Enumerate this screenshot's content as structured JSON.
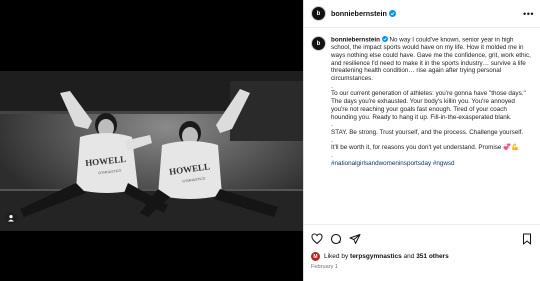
{
  "header": {
    "username": "bonniebernstein",
    "more_label": "•••"
  },
  "caption": {
    "username": "bonniebernstein",
    "paragraph1": "No way I could've known, senior year in high school, the impact sports would have on my life. How it molded me in ways nothing else could have. Gave me the confidence, grit, work ethic, and resilience I'd need to make it in the sports industry… survive a life threatening health condition… rise again after trying personal circumstances.",
    "dot": ".",
    "paragraph2": "To our current generation of athletes: you're gonna have \"those days.\" The days you're exhausted. Your body's killin you. You're annoyed you're not reaching your goals fast enough. Tired of your coach hounding you. Ready to hang it up. Fill-in-the-exasperated blank.",
    "paragraph3": "STAY. Be strong. Trust yourself, and the process. Challenge yourself.",
    "paragraph4": "It'll be worth it, for reasons you don't yet understand. Promise",
    "emoji": "💞💪",
    "hashtags": "#nationalgirlsandwomeninsportsday #ngwsd"
  },
  "photo": {
    "sweatshirt_text_left": "HOWELL",
    "sweatshirt_text_right": "HOWELL",
    "sweatshirt_sub_left": "GYMNASTICS",
    "sweatshirt_sub_right": "GYMNASTICS"
  },
  "likes": {
    "prefix": "Liked by",
    "first_liker": "terpsgymnastics",
    "and": "and",
    "others": "351 others"
  },
  "date": "February 1",
  "colors": {
    "link": "#00376b",
    "verified": "#0095f6"
  },
  "icons": [
    "heart-icon",
    "comment-icon",
    "share-icon",
    "bookmark-icon",
    "verified-icon",
    "tag-user-icon"
  ]
}
